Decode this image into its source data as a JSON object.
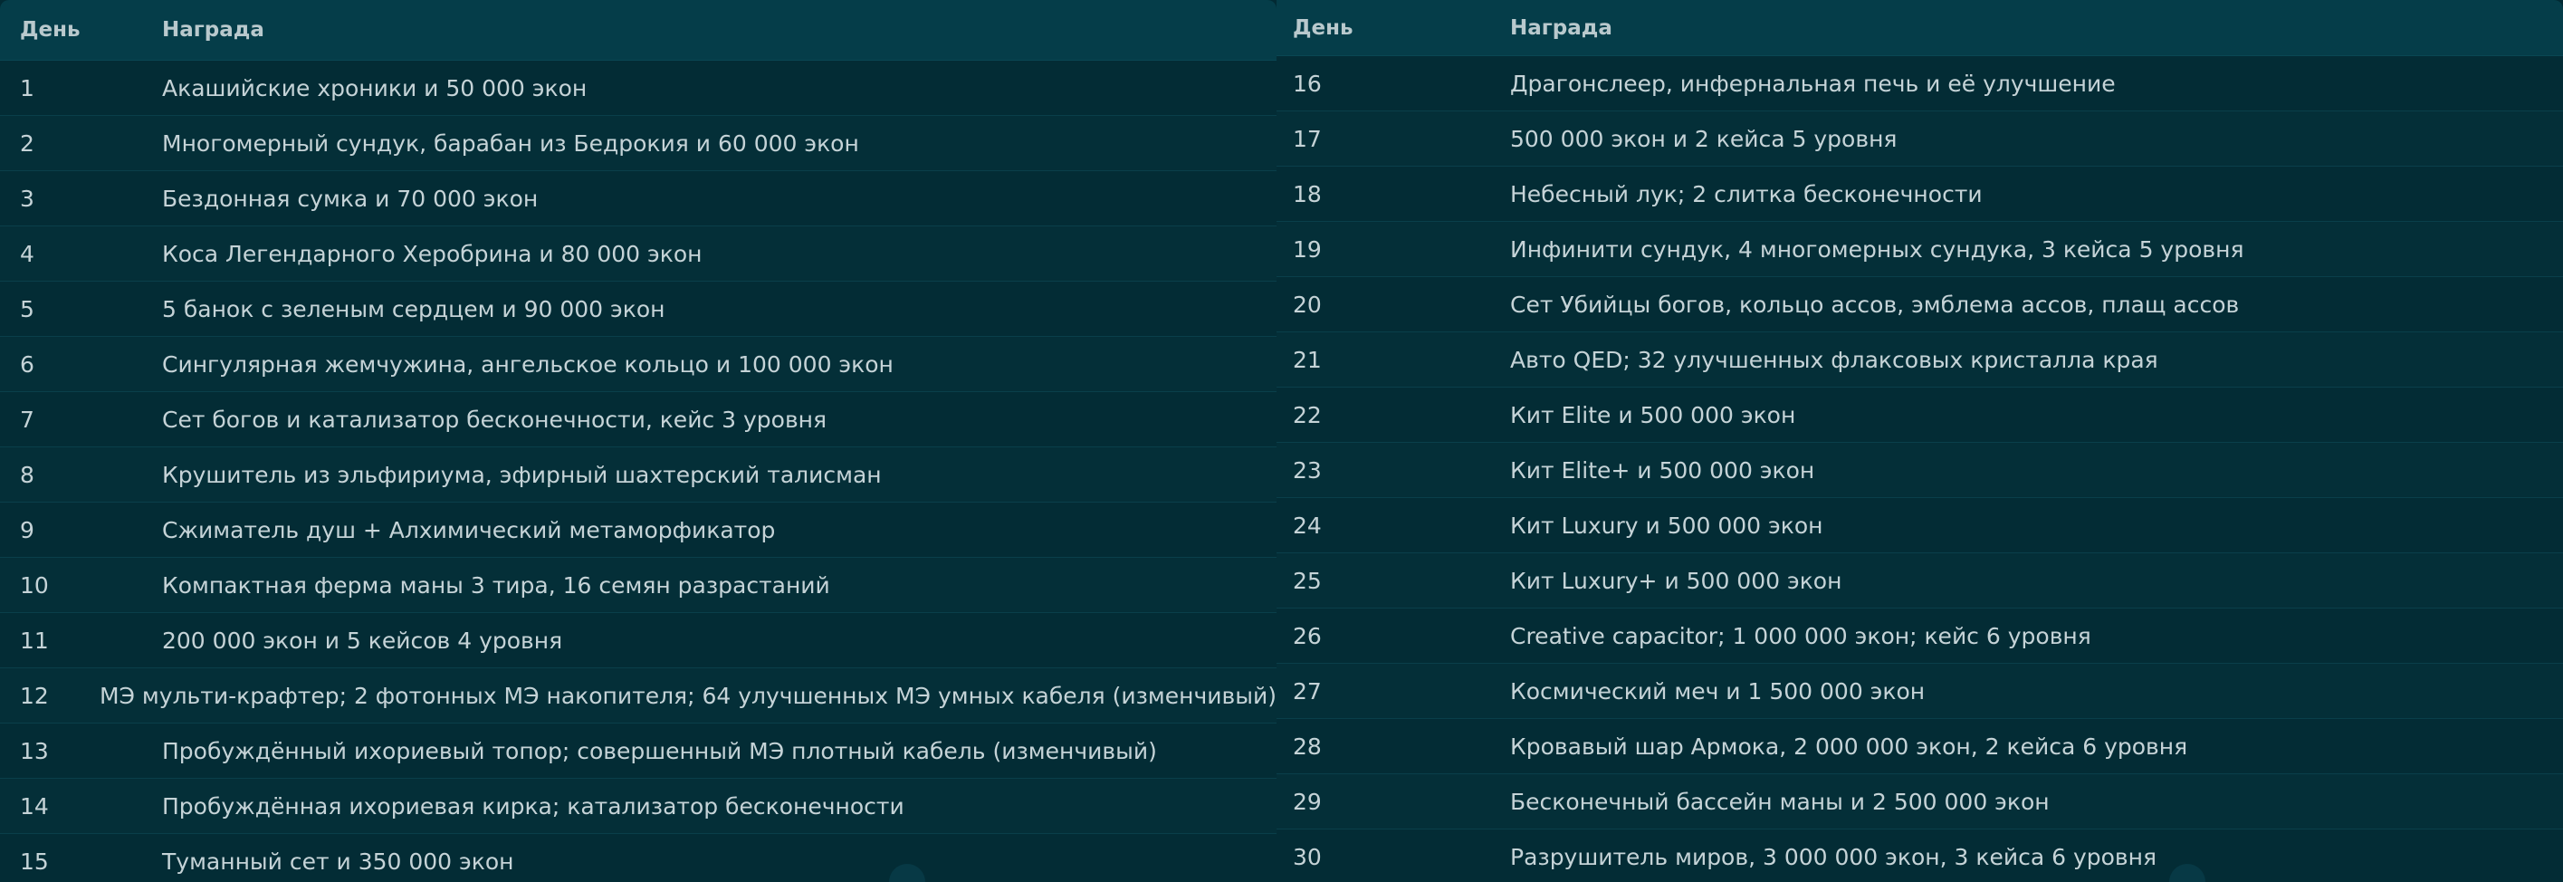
{
  "left_table": {
    "header": {
      "day": "День",
      "reward": "Награда"
    },
    "rows": [
      {
        "day": "1",
        "reward": "Акашийские хроники и 50 000 экон"
      },
      {
        "day": "2",
        "reward": "Многомерный сундук, барабан из Бедрокия и 60 000 экон"
      },
      {
        "day": "3",
        "reward": "Бездонная сумка и 70 000 экон"
      },
      {
        "day": "4",
        "reward": "Коса Легендарного Херобрина и 80 000 экон"
      },
      {
        "day": "5",
        "reward": "5 банок с зеленым сердцем и 90 000 экон"
      },
      {
        "day": "6",
        "reward": "Сингулярная жемчужина, ангельское кольцо и 100 000 экон"
      },
      {
        "day": "7",
        "reward": "Сет богов и катализатор бесконечности, кейс 3 уровня"
      },
      {
        "day": "8",
        "reward": "Крушитель из эльфириума, эфирный шахтерский талисман"
      },
      {
        "day": "9",
        "reward": "Сжиматель душ + Алхимический метаморфикатор"
      },
      {
        "day": "10",
        "reward": "Компактная ферма маны 3 тира, 16 семян разрастаний"
      },
      {
        "day": "11",
        "reward": "200 000 экон и 5 кейсов 4 уровня"
      },
      {
        "day": "12",
        "reward": "МЭ мульти-крафтер; 2 фотонных МЭ накопителя; 64 улучшенных МЭ умных кабеля (изменчивый)"
      },
      {
        "day": "13",
        "reward": "Пробуждённый ихориевый топор; совершенный МЭ плотный кабель (изменчивый)"
      },
      {
        "day": "14",
        "reward": "Пробуждённая ихориевая кирка; катализатор бесконечности"
      },
      {
        "day": "15",
        "reward": "Туманный сет и 350 000 экон"
      }
    ]
  },
  "right_table": {
    "header": {
      "day": "День",
      "reward": "Награда"
    },
    "rows": [
      {
        "day": "16",
        "reward": "Драгонслеер, инфернальная печь и её улучшение"
      },
      {
        "day": "17",
        "reward": "500 000 экон и 2 кейса 5 уровня"
      },
      {
        "day": "18",
        "reward": "Небесный лук; 2 слитка бесконечности"
      },
      {
        "day": "19",
        "reward": "Инфинити сундук, 4 многомерных сундука, 3 кейса 5 уровня"
      },
      {
        "day": "20",
        "reward": "Сет Убийцы богов, кольцо ассов, эмблема ассов, плащ ассов"
      },
      {
        "day": "21",
        "reward": "Авто QED; 32 улучшенных флаксовых кристалла края"
      },
      {
        "day": "22",
        "reward": "Кит Elite и 500 000 экон"
      },
      {
        "day": "23",
        "reward": "Кит Elite+ и 500 000 экон"
      },
      {
        "day": "24",
        "reward": "Кит Luxury и 500 000 экон"
      },
      {
        "day": "25",
        "reward": "Кит Luxury+ и 500 000 экон"
      },
      {
        "day": "26",
        "reward": "Creative capacitor; 1 000 000 экон; кейс 6 уровня"
      },
      {
        "day": "27",
        "reward": "Космический меч и 1 500 000 экон"
      },
      {
        "day": "28",
        "reward": "Кровавый шар Армока, 2 000 000 экон, 2 кейса 6 уровня"
      },
      {
        "day": "29",
        "reward": "Бесконечный бассейн маны и 2 500 000 экон"
      },
      {
        "day": "30",
        "reward": "Разрушитель миров, 3 000 000 экон, 3 кейса 6 уровня"
      }
    ]
  }
}
